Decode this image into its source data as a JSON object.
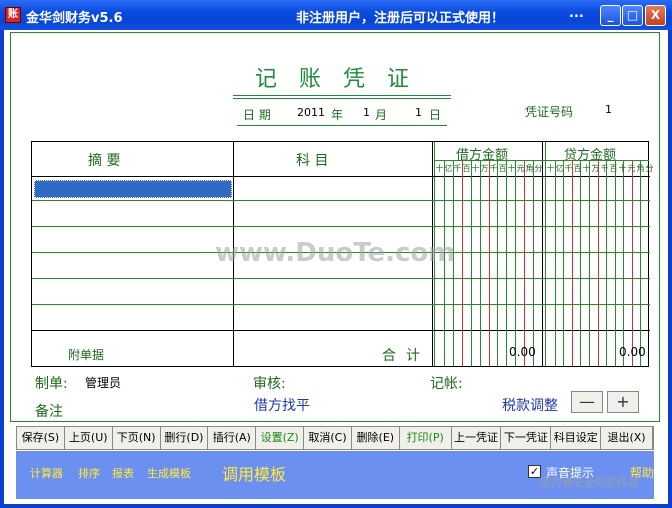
{
  "window": {
    "title": "金华剑财务v5.6",
    "notice": "非注册用户，注册后可以正式使用！",
    "dots": "...",
    "min": "_",
    "max": "□",
    "close": "X",
    "app_icon": "账"
  },
  "voucher": {
    "title": "记账凭证",
    "date_labels": {
      "date": "日  期",
      "year": "年",
      "month": "月",
      "day": "日"
    },
    "date": {
      "year": "2011",
      "month": "1",
      "day": "1"
    },
    "number_label": "凭证号码",
    "number": "1",
    "columns": {
      "summary": "摘    要",
      "subject": "科    目",
      "debit": "借方金额",
      "credit": "贷方金额"
    },
    "units": [
      "十",
      "亿",
      "千",
      "百",
      "十",
      "万",
      "千",
      "百",
      "十",
      "元",
      "角",
      "分"
    ],
    "attachments_label": "附单据",
    "total_label": "合计",
    "debit_total": "0.00",
    "credit_total": "0.00"
  },
  "signatures": {
    "maker_label": "制单:",
    "maker": "管理员",
    "reviewer_label": "审核:",
    "bookkeeper_label": "记帐:",
    "note_label": "备注",
    "balance_status": "借方找平",
    "tax_adjust_label": "税款调整",
    "minus": "—",
    "plus": "+"
  },
  "toolbar": [
    {
      "label": "保存(S)",
      "w": 48
    },
    {
      "label": "上页(U)",
      "w": 48
    },
    {
      "label": "下页(N)",
      "w": 48
    },
    {
      "label": "删行(D)",
      "w": 48
    },
    {
      "label": "插行(A)",
      "w": 48
    },
    {
      "label": "设置(Z)",
      "w": 48,
      "green": true
    },
    {
      "label": "取消(C)",
      "w": 48
    },
    {
      "label": "删除(E)",
      "w": 48
    },
    {
      "label": "打印(P)",
      "w": 52,
      "green": true
    },
    {
      "label": "上一凭证",
      "w": 50
    },
    {
      "label": "下一凭证",
      "w": 50
    },
    {
      "label": "科目设定",
      "w": 50
    },
    {
      "label": "退出(X)",
      "w": 52
    }
  ],
  "bottom_links": [
    "计算器",
    "排序",
    "报表",
    "生成模板"
  ],
  "template_button": "调用模板",
  "sound_label": "声音提示",
  "sound_checked": "✓",
  "help_label": "帮助",
  "watermark": "www.DuoTe.com",
  "watermark2": "国内最安全的软件站"
}
